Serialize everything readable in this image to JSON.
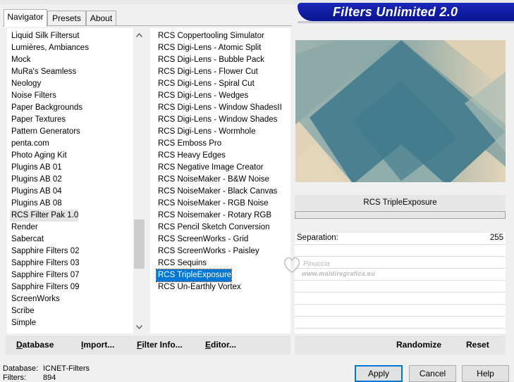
{
  "tabs": [
    {
      "label": "Navigator",
      "active": true
    },
    {
      "label": "Presets",
      "active": false
    },
    {
      "label": "About",
      "active": false
    }
  ],
  "banner": {
    "title": "Filters Unlimited 2.0"
  },
  "categories": {
    "items": [
      "Liquid Silk Filtersut",
      "Lumières, Ambiances",
      "Mock",
      "MuRa's Seamless",
      "Neology",
      "Noise Filters",
      "Paper Backgrounds",
      "Paper Textures",
      "Pattern Generators",
      "penta.com",
      "Photo Aging Kit",
      "Plugins AB 01",
      "Plugins AB 02",
      "Plugins AB 04",
      "Plugins AB 08",
      "RCS Filter Pak 1.0",
      "Render",
      "Sabercat",
      "Sapphire Filters 02",
      "Sapphire Filters 03",
      "Sapphire Filters 07",
      "Sapphire Filters 09",
      "ScreenWorks",
      "Scribe",
      "Simple"
    ],
    "selected": "RCS Filter Pak 1.0"
  },
  "filters": {
    "items": [
      "RCS Coppertooling Simulator",
      "RCS Digi-Lens - Atomic Split",
      "RCS Digi-Lens - Bubble Pack",
      "RCS Digi-Lens - Flower Cut",
      "RCS Digi-Lens - Spiral Cut",
      "RCS Digi-Lens - Wedges",
      "RCS Digi-Lens - Window ShadesII",
      "RCS Digi-Lens - Window Shades",
      "RCS Digi-Lens - Wormhole",
      "RCS Emboss Pro",
      "RCS Heavy Edges",
      "RCS Negative Image Creator",
      "RCS NoiseMaker - B&W Noise",
      "RCS NoiseMaker - Black Canvas",
      "RCS NoiseMaker - RGB Noise",
      "RCS Noisemaker - Rotary RGB",
      "RCS Pencil Sketch Conversion",
      "RCS ScreenWorks - Grid",
      "RCS ScreenWorks - Paisley",
      "RCS Sequins",
      "RCS TripleExposure",
      "RCS Un-Earthly Vortex"
    ],
    "selected": "RCS TripleExposure"
  },
  "preview": {
    "filter_name": "RCS TripleExposure",
    "colors": {
      "teal_dark": "#437e8e",
      "teal_mid": "#7ea4a6",
      "beige": "#ddd0b4"
    }
  },
  "parameters": [
    {
      "label": "Separation:",
      "value": "255"
    }
  ],
  "watermark": {
    "line1": "Pinuccia",
    "line2": "www.maldiregrafica.eu"
  },
  "left_bar": {
    "database": "Database",
    "import": "Import...",
    "filter_info": "Filter Info...",
    "editor": "Editor..."
  },
  "right_bar": {
    "randomize": "Randomize",
    "reset": "Reset"
  },
  "status": {
    "database_label": "Database:",
    "database_value": "ICNET-Filters",
    "filters_label": "Filters:",
    "filters_value": "894"
  },
  "buttons": {
    "apply": "Apply",
    "cancel": "Cancel",
    "help": "Help"
  }
}
